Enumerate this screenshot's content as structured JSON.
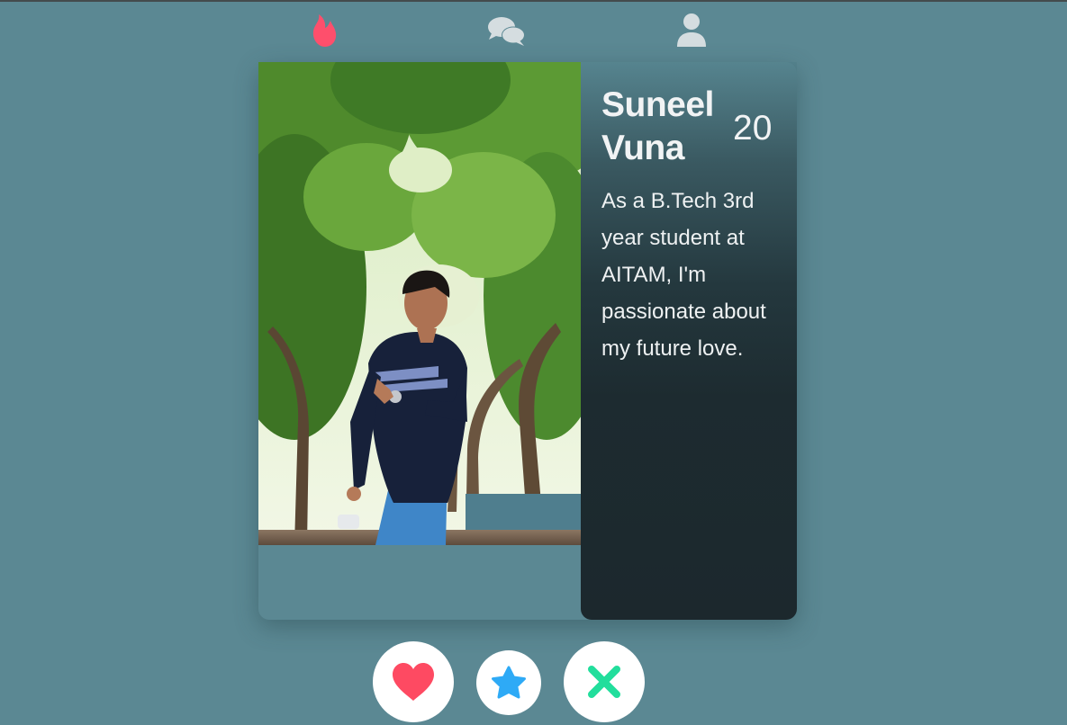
{
  "nav": {
    "items": [
      {
        "icon": "fire-icon",
        "color": "#fe4f6c",
        "active": true
      },
      {
        "icon": "chat-bubbles-icon",
        "color": "#d5dde0",
        "active": false
      },
      {
        "icon": "user-icon",
        "color": "#d5dde0",
        "active": false
      }
    ]
  },
  "profile": {
    "name": "Suneel Vuna",
    "age": "20",
    "bio": "As a B.Tech 3rd year student at AITAM, I'm passionate about my future love.",
    "photo_alt": "profile-photo"
  },
  "actions": [
    {
      "icon": "heart-icon",
      "color": "#fe4a62"
    },
    {
      "icon": "star-icon",
      "color": "#2eaaf6"
    },
    {
      "icon": "x-icon",
      "color": "#22de9c"
    }
  ],
  "colors": {
    "background": "#5b8893",
    "info_panel": "#1c282d",
    "accent": "#fe4f6c"
  }
}
